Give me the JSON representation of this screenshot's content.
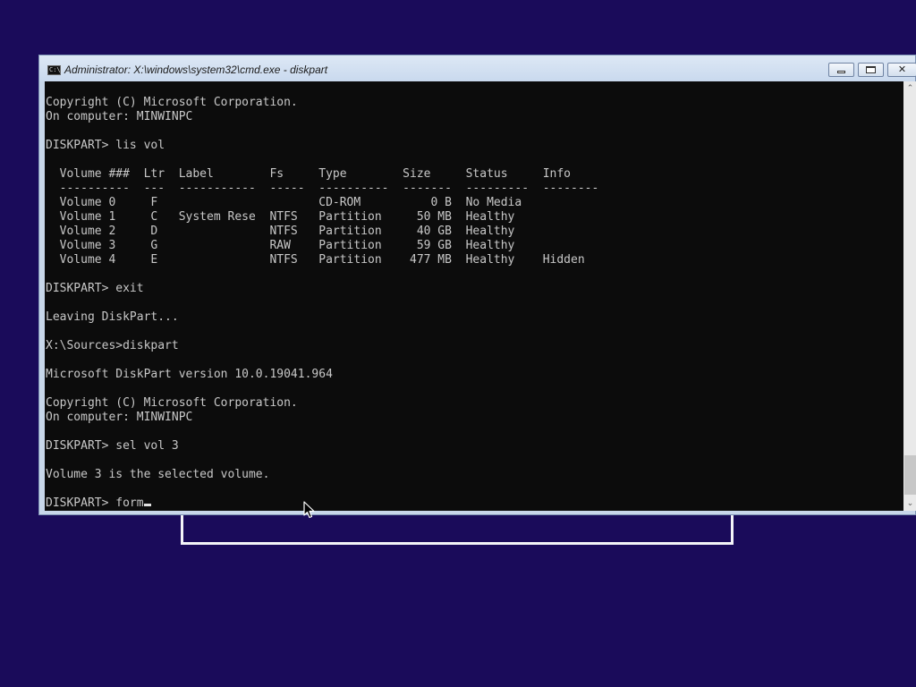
{
  "window": {
    "title": "Administrator: X:\\windows\\system32\\cmd.exe - diskpart",
    "icon_text": "C:\\.",
    "controls": {
      "minimize_icon": "minimize-icon",
      "maximize_icon": "maximize-icon",
      "close_label": "✕"
    }
  },
  "console": {
    "lines_before_prompt": [
      "Copyright (C) Microsoft Corporation.",
      "On computer: MINWINPC",
      "",
      "DISKPART> lis vol",
      "",
      "  Volume ###  Ltr  Label        Fs     Type        Size     Status     Info",
      "  ----------  ---  -----------  -----  ----------  -------  ---------  --------",
      "  Volume 0     F                       CD-ROM          0 B  No Media",
      "  Volume 1     C   System Rese  NTFS   Partition     50 MB  Healthy",
      "  Volume 2     D                NTFS   Partition     40 GB  Healthy",
      "  Volume 3     G                RAW    Partition     59 GB  Healthy",
      "  Volume 4     E                NTFS   Partition    477 MB  Healthy    Hidden",
      "",
      "DISKPART> exit",
      "",
      "Leaving DiskPart...",
      "",
      "X:\\Sources>diskpart",
      "",
      "Microsoft DiskPart version 10.0.19041.964",
      "",
      "Copyright (C) Microsoft Corporation.",
      "On computer: MINWINPC",
      "",
      "DISKPART> sel vol 3",
      "",
      "Volume 3 is the selected volume.",
      ""
    ],
    "prompt": "DISKPART> ",
    "current_input": "form"
  },
  "scrollbar": {
    "up_arrow": "⌃",
    "down_arrow": "⌄",
    "position_fraction": 0.97
  },
  "colors": {
    "desktop_background": "#1a0b5a",
    "console_background": "#0c0c0c",
    "console_text": "#c8c8c8"
  }
}
